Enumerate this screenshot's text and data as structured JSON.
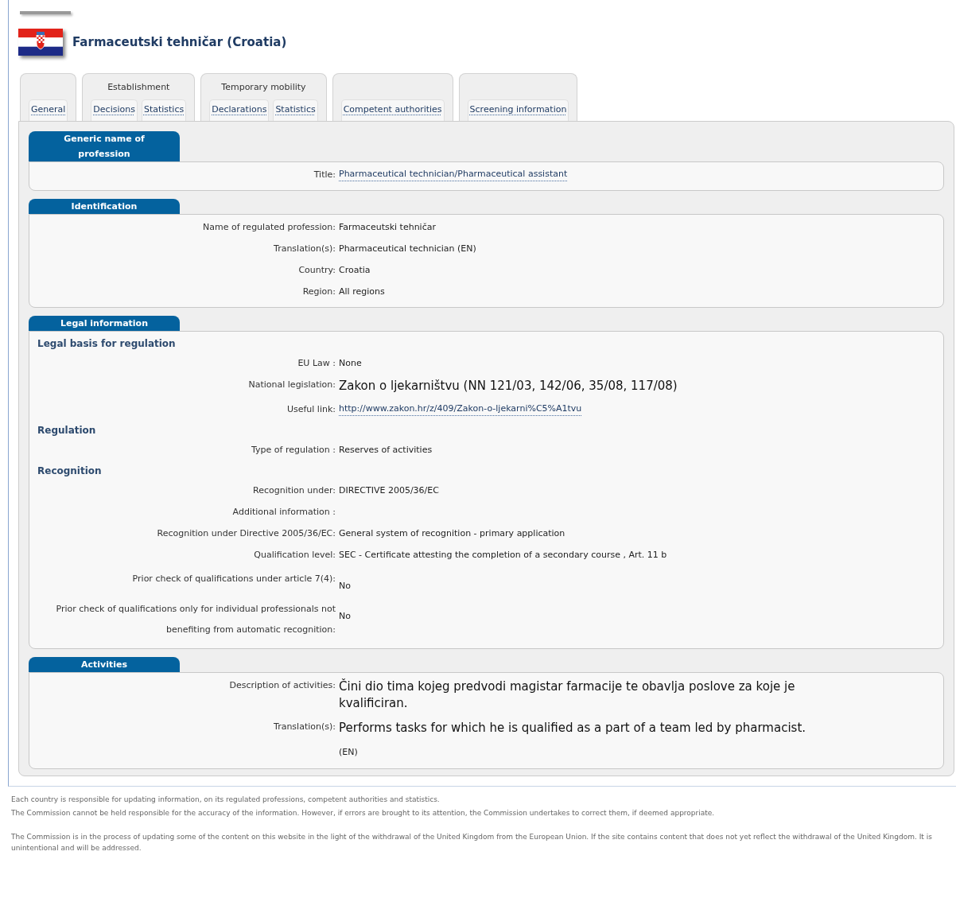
{
  "title": "Farmaceutski tehničar (Croatia)",
  "tab_groups": [
    {
      "tabs": [
        "General"
      ]
    },
    {
      "header": "Establishment",
      "tabs": [
        "Decisions",
        "Statistics"
      ]
    },
    {
      "header": "Temporary mobility",
      "tabs": [
        "Declarations",
        "Statistics"
      ]
    },
    {
      "tabs": [
        "Competent authorities"
      ]
    },
    {
      "tabs": [
        "Screening information"
      ]
    }
  ],
  "sections": [
    {
      "title": "Generic name of profession",
      "rows": [
        {
          "kind": "link",
          "label": "Title:",
          "value": "Pharmaceutical technician/Pharmaceutical assistant"
        }
      ]
    },
    {
      "title": "Identification",
      "rows": [
        {
          "kind": "field",
          "label": "Name of regulated profession:",
          "value": "Farmaceutski tehničar"
        },
        {
          "kind": "field",
          "label": "Translation(s):",
          "value": "Pharmaceutical technician (EN)"
        },
        {
          "kind": "field",
          "label": "Country:",
          "value": "Croatia"
        },
        {
          "kind": "field",
          "label": "Region:",
          "value": "All regions"
        }
      ]
    },
    {
      "title": "Legal information",
      "rows": [
        {
          "kind": "subheading",
          "label": "Legal basis for regulation"
        },
        {
          "kind": "field",
          "label": "EU Law :",
          "value": "None"
        },
        {
          "kind": "large",
          "label": "National legislation:",
          "value": "Zakon o ljekarništvu (NN 121/03, 142/06, 35/08, 117/08)"
        },
        {
          "kind": "link",
          "label": "Useful link:",
          "value": "http://www.zakon.hr/z/409/Zakon-o-ljekarni%C5%A1tvu"
        },
        {
          "kind": "subheading",
          "label": "Regulation"
        },
        {
          "kind": "field",
          "label": "Type of regulation :",
          "value": "Reserves of activities"
        },
        {
          "kind": "subheading",
          "label": "Recognition"
        },
        {
          "kind": "field",
          "label": "Recognition under:",
          "value": "DIRECTIVE 2005/36/EC"
        },
        {
          "kind": "field",
          "label": "Additional information :"
        },
        {
          "kind": "field",
          "label": "Recognition under Directive 2005/36/EC:",
          "value": "General system of recognition - primary application"
        },
        {
          "kind": "field",
          "label": "Qualification level:",
          "value": "SEC - Certificate attesting the completion of a secondary course , Art. 11 b"
        },
        {
          "kind": "tall",
          "label": "Prior check of qualifications under article 7(4):",
          "value": "No"
        },
        {
          "kind": "tall",
          "label": "Prior check of qualifications only for individual professionals not benefiting from automatic recognition:",
          "value": "No"
        }
      ]
    },
    {
      "title": "Activities",
      "rows": [
        {
          "kind": "large",
          "label": "Description of activities:",
          "value": "Čini dio tima kojeg predvodi magistar farmacije te obavlja poslove za koje je kvalificiran."
        },
        {
          "kind": "large",
          "label": "Translation(s):",
          "value": "Performs tasks for which he is qualified as a part of a team led by pharmacist.",
          "note": "(EN)"
        }
      ]
    }
  ],
  "footer": [
    "Each country is responsible for updating information, on its regulated professions, competent authorities and statistics.",
    "The Commission cannot be held responsible for the accuracy of the information. However, if errors are brought to its attention, the Commission undertakes to correct them, if deemed appropriate.",
    "The Commission is in the process of updating some of the content on this website in the light of the withdrawal of the United Kingdom from the European Union. If the site contains content that does not yet reflect the withdrawal of the United Kingdom. It is unintentional and will be addressed."
  ]
}
